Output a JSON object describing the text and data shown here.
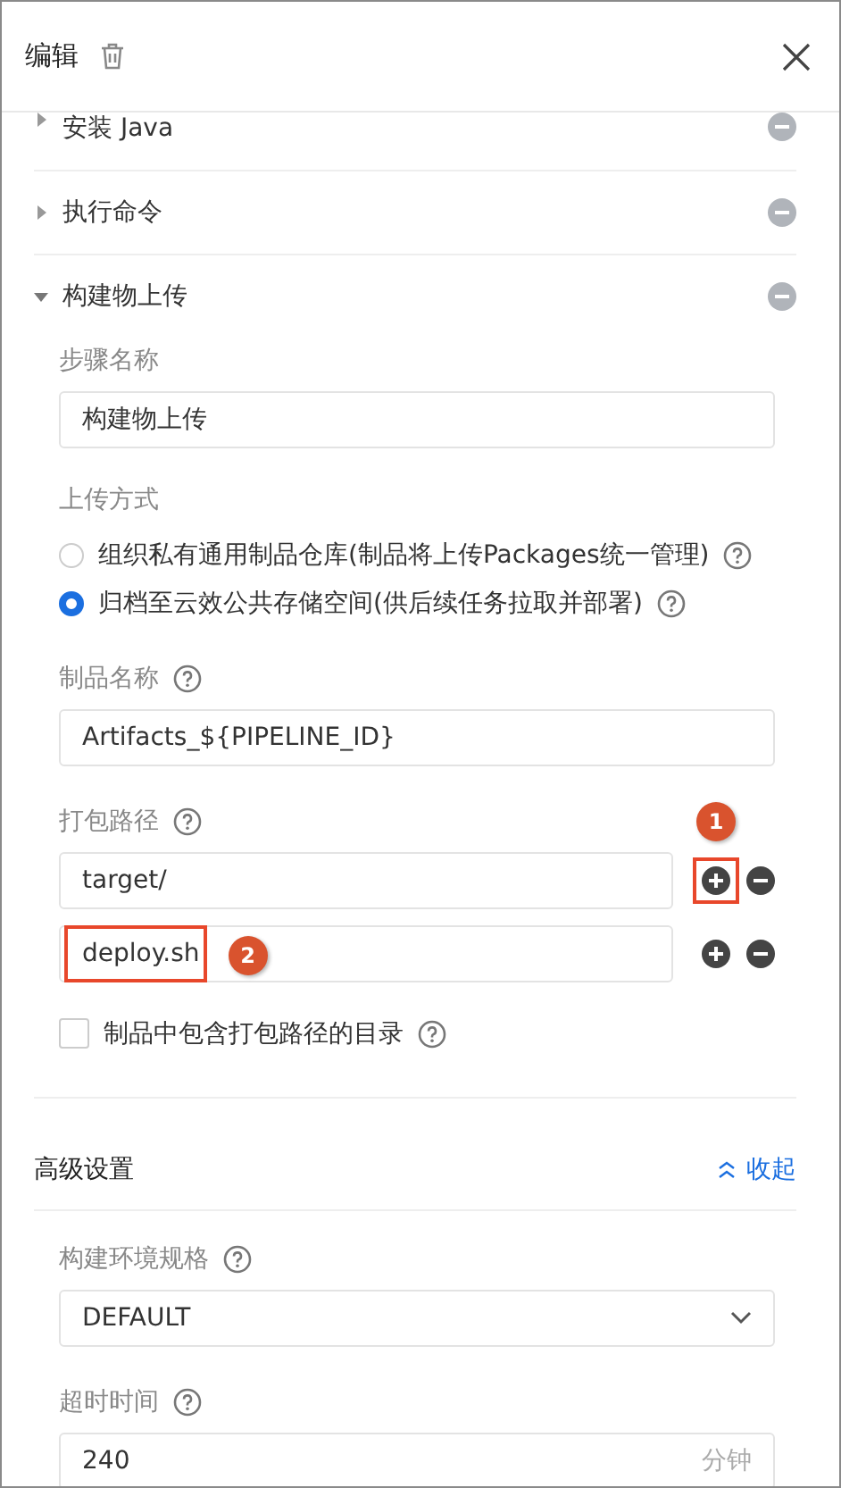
{
  "header": {
    "title": "编辑"
  },
  "steps": [
    {
      "name": "安装 Java",
      "expanded": false
    },
    {
      "name": "执行命令",
      "expanded": false
    },
    {
      "name": "构建物上传",
      "expanded": true
    }
  ],
  "step_name": {
    "label": "步骤名称",
    "value": "构建物上传"
  },
  "upload_method": {
    "label": "上传方式",
    "options": [
      {
        "label": "组织私有通用制品仓库(制品将上传Packages统一管理)",
        "selected": false
      },
      {
        "label": "归档至云效公共存储空间(供后续任务拉取并部署)",
        "selected": true
      }
    ]
  },
  "artifact_name": {
    "label": "制品名称",
    "value": "Artifacts_${PIPELINE_ID}"
  },
  "pack_paths": {
    "label": "打包路径",
    "rows": [
      {
        "value": "target/",
        "callout": {
          "kind": "button",
          "label": "1"
        }
      },
      {
        "value": "deploy.sh",
        "callout": {
          "kind": "text",
          "label": "2"
        }
      }
    ]
  },
  "include_dir": {
    "label": "制品中包含打包路径的目录",
    "checked": false
  },
  "advanced": {
    "title": "高级设置",
    "toggle": "收起",
    "expanded": true
  },
  "env_spec": {
    "label": "构建环境规格",
    "value": "DEFAULT"
  },
  "timeout": {
    "label": "超时时间",
    "value": "240",
    "unit": "分钟"
  }
}
